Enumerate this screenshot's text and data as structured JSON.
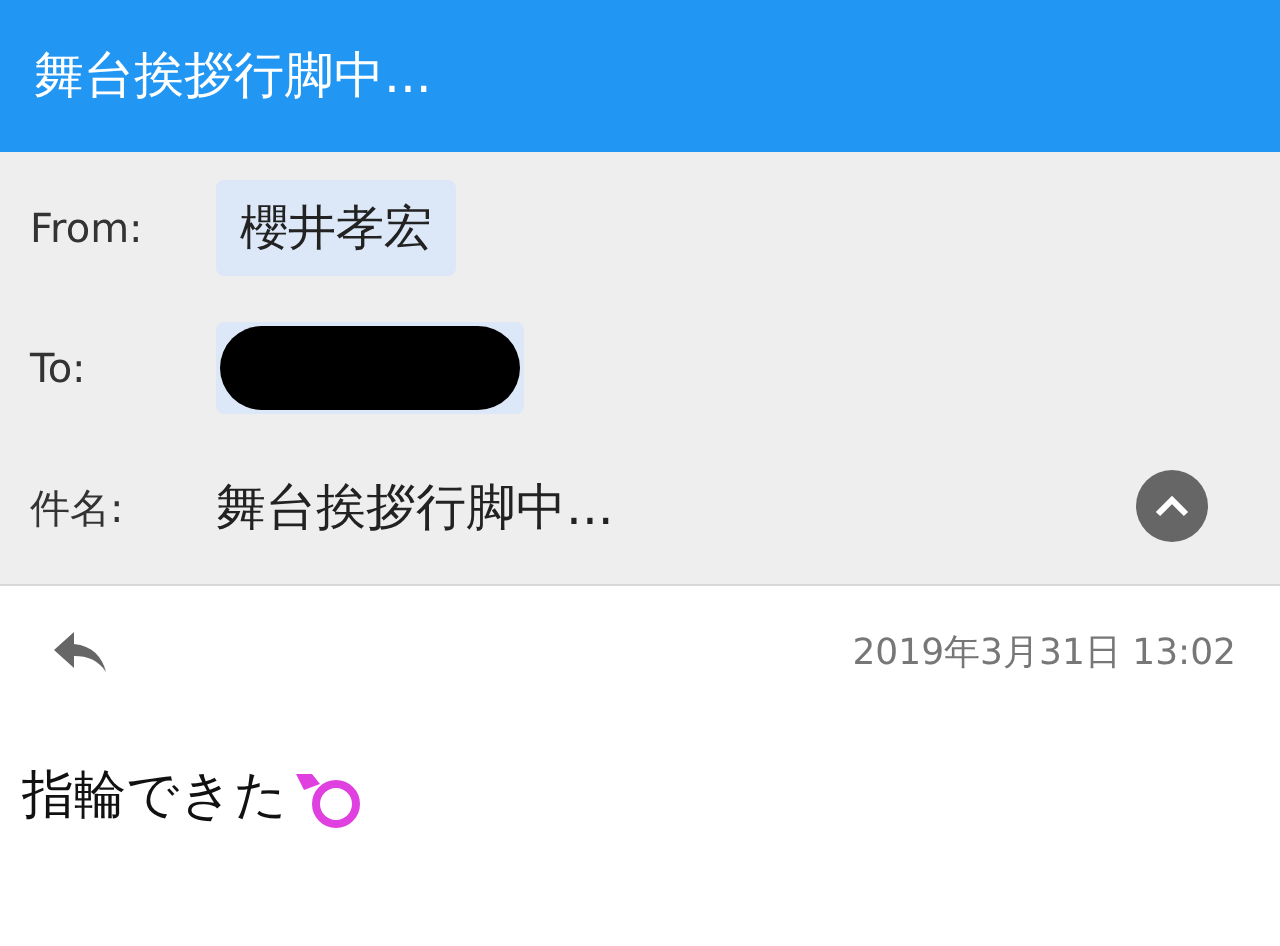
{
  "header": {
    "title": "舞台挨拶行脚中..."
  },
  "fields": [
    {
      "kind": "chip",
      "label": "From:",
      "value": "櫻井孝宏",
      "redacted": false
    },
    {
      "kind": "chip",
      "label": "To:",
      "redacted": true
    },
    {
      "kind": "text",
      "label": "件名:",
      "value": "舞台挨拶行脚中..."
    }
  ],
  "details": {
    "expanded": true
  },
  "date": "2019年3月31日 13:02",
  "body": "指輪できた"
}
